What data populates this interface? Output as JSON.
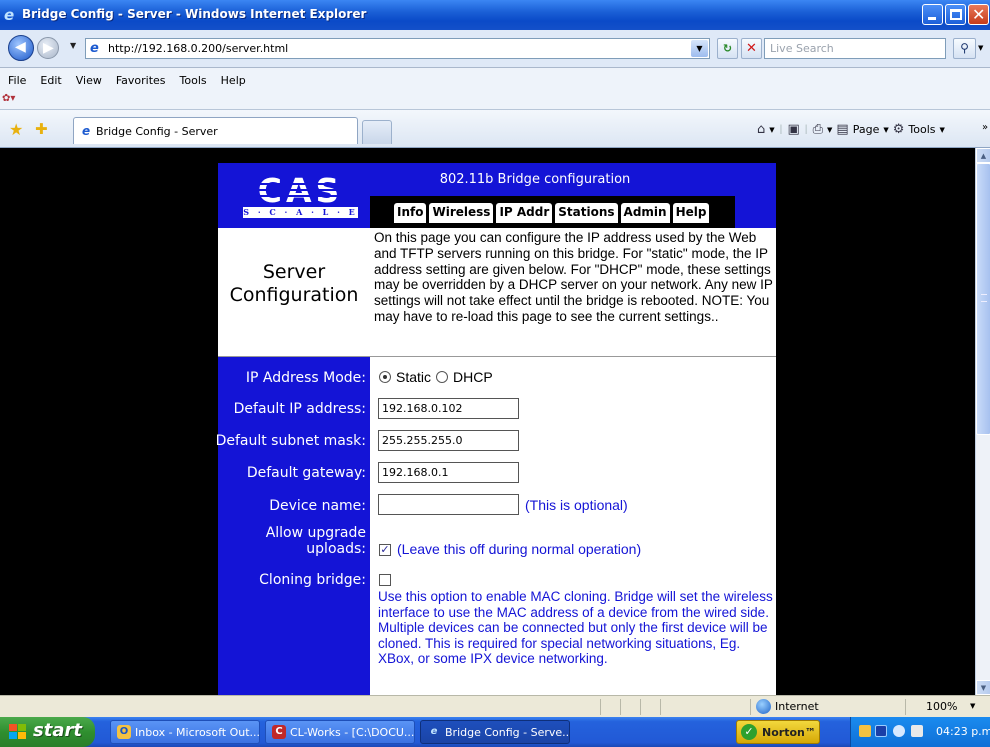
{
  "window": {
    "title": "Bridge Config - Server - Windows Internet Explorer"
  },
  "address_bar": {
    "url": "http://192.168.0.200/server.html",
    "search_placeholder": "Live Search"
  },
  "menu": {
    "items": [
      "File",
      "Edit",
      "View",
      "Favorites",
      "Tools",
      "Help"
    ]
  },
  "tabs": {
    "active_tab_label": "Bridge Config - Server",
    "command_page": "Page",
    "command_tools": "Tools"
  },
  "page": {
    "logo_text": "CAS",
    "logo_subtext": "S · C · A · L · E",
    "header_title": "802.11b Bridge configuration",
    "nav": [
      "Info",
      "Wireless",
      "IP Addr",
      "Stations",
      "Admin",
      "Help"
    ],
    "section_title_line1": "Server",
    "section_title_line2": "Configuration",
    "description": "On this page you can configure the IP address used by the Web and TFTP servers running on this bridge. For \"static\" mode, the IP address setting are given below. For \"DHCP\" mode, these settings may be overridden by a DHCP server on your network. Any new IP settings will not take effect until the bridge is rebooted. NOTE: You may have to re-load this page to see the current settings..",
    "form": {
      "ip_mode_label": "IP Address Mode:",
      "ip_mode_options": [
        "Static",
        "DHCP"
      ],
      "ip_mode_selected": "Static",
      "default_ip_label": "Default IP address:",
      "default_ip_value": "192.168.0.102",
      "subnet_label": "Default subnet mask:",
      "subnet_value": "255.255.255.0",
      "gateway_label": "Default gateway:",
      "gateway_value": "192.168.0.1",
      "device_name_label": "Device name:",
      "device_name_value": "",
      "device_name_hint": "(This is optional)",
      "allow_upgrade_label_line1": "Allow upgrade",
      "allow_upgrade_label_line2": "uploads:",
      "allow_upgrade_checked": true,
      "allow_upgrade_hint": "(Leave this off during normal operation)",
      "cloning_label": "Cloning bridge:",
      "cloning_checked": false,
      "cloning_description": "Use this option to enable MAC cloning. Bridge will set the wireless interface to use the MAC address of a device from the wired side. Multiple devices can be connected but only the first device will be cloned. This is required for special networking situations, Eg. XBox, or some IPX device networking."
    }
  },
  "status_bar": {
    "zone": "Internet",
    "zoom": "100%"
  },
  "taskbar": {
    "start_label": "start",
    "tasks": [
      {
        "label": "Inbox - Microsoft Out...",
        "icon": "outlook-icon"
      },
      {
        "label": "CL-Works - [C:\\DOCU...",
        "icon": "clworks-icon"
      },
      {
        "label": "Bridge Config - Serve...",
        "icon": "ie-icon"
      }
    ],
    "norton_label": "Norton™",
    "clock": "04:23 p.m."
  },
  "colors": {
    "page_blue": "#1414d6",
    "xp_blue": "#2462dd",
    "start_green": "#2f8f2f"
  }
}
